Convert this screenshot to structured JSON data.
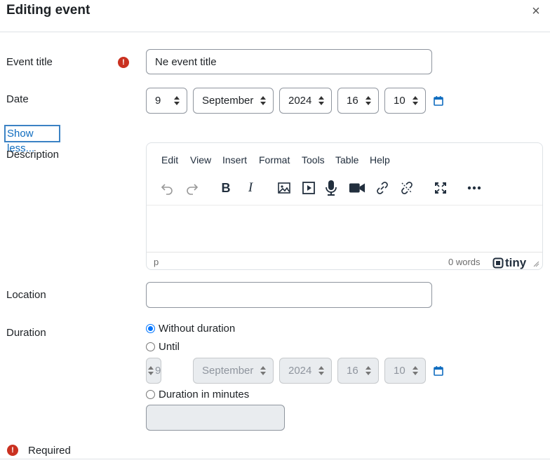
{
  "dialog": {
    "title": "Editing event",
    "close_label": "×"
  },
  "event_title": {
    "label": "Event title",
    "required_icon": "exclamation-circle-icon",
    "value": "Ne event title"
  },
  "date": {
    "label": "Date",
    "day": "9",
    "month": "September",
    "year": "2024",
    "hour": "16",
    "minute": "10",
    "calendar_icon": "calendar-icon"
  },
  "show_less": "Show less...",
  "description": {
    "label": "Description",
    "menu": [
      "Edit",
      "View",
      "Insert",
      "Format",
      "Tools",
      "Table",
      "Help"
    ],
    "toolbar_icons": [
      "undo-icon",
      "redo-icon",
      "bold-icon",
      "italic-icon",
      "image-icon",
      "media-icon",
      "microphone-icon",
      "video-camera-icon",
      "link-icon",
      "unlink-icon",
      "fullscreen-icon",
      "more-icon"
    ],
    "bold_glyph": "B",
    "italic_glyph": "I",
    "path": "p",
    "word_count": "0 words",
    "brand": "tiny"
  },
  "location": {
    "label": "Location",
    "value": ""
  },
  "duration": {
    "label": "Duration",
    "options": {
      "without": "Without duration",
      "until": "Until",
      "minutes": "Duration in minutes"
    },
    "selected": "without",
    "until_date": {
      "day": "9",
      "month": "September",
      "year": "2024",
      "hour": "16",
      "minute": "10"
    },
    "minutes_value": ""
  },
  "footer": {
    "required_text": "Required"
  },
  "colors": {
    "accent": "#0f6cbf",
    "required": "#ca3120",
    "radio": "#0075ff"
  }
}
